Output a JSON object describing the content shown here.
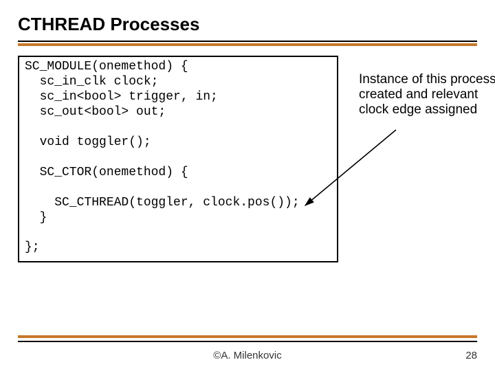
{
  "title": "CTHREAD Processes",
  "code": {
    "l1": "SC_MODULE(onemethod) {",
    "l2": "  sc_in_clk clock;",
    "l3": "  sc_in<bool> trigger, in;",
    "l4": "  sc_out<bool> out;",
    "l5": "",
    "l6": "  void toggler();",
    "l7": "",
    "l8": "  SC_CTOR(onemethod) {",
    "l9": "",
    "l10": "    SC_CTHREAD(toggler, clock.pos());",
    "l11": "  }",
    "l12": "",
    "l13": "};"
  },
  "annotation": "Instance of this process created and relevant clock edge assigned",
  "footer": {
    "author": "©A. Milenkovic",
    "page": "28"
  }
}
